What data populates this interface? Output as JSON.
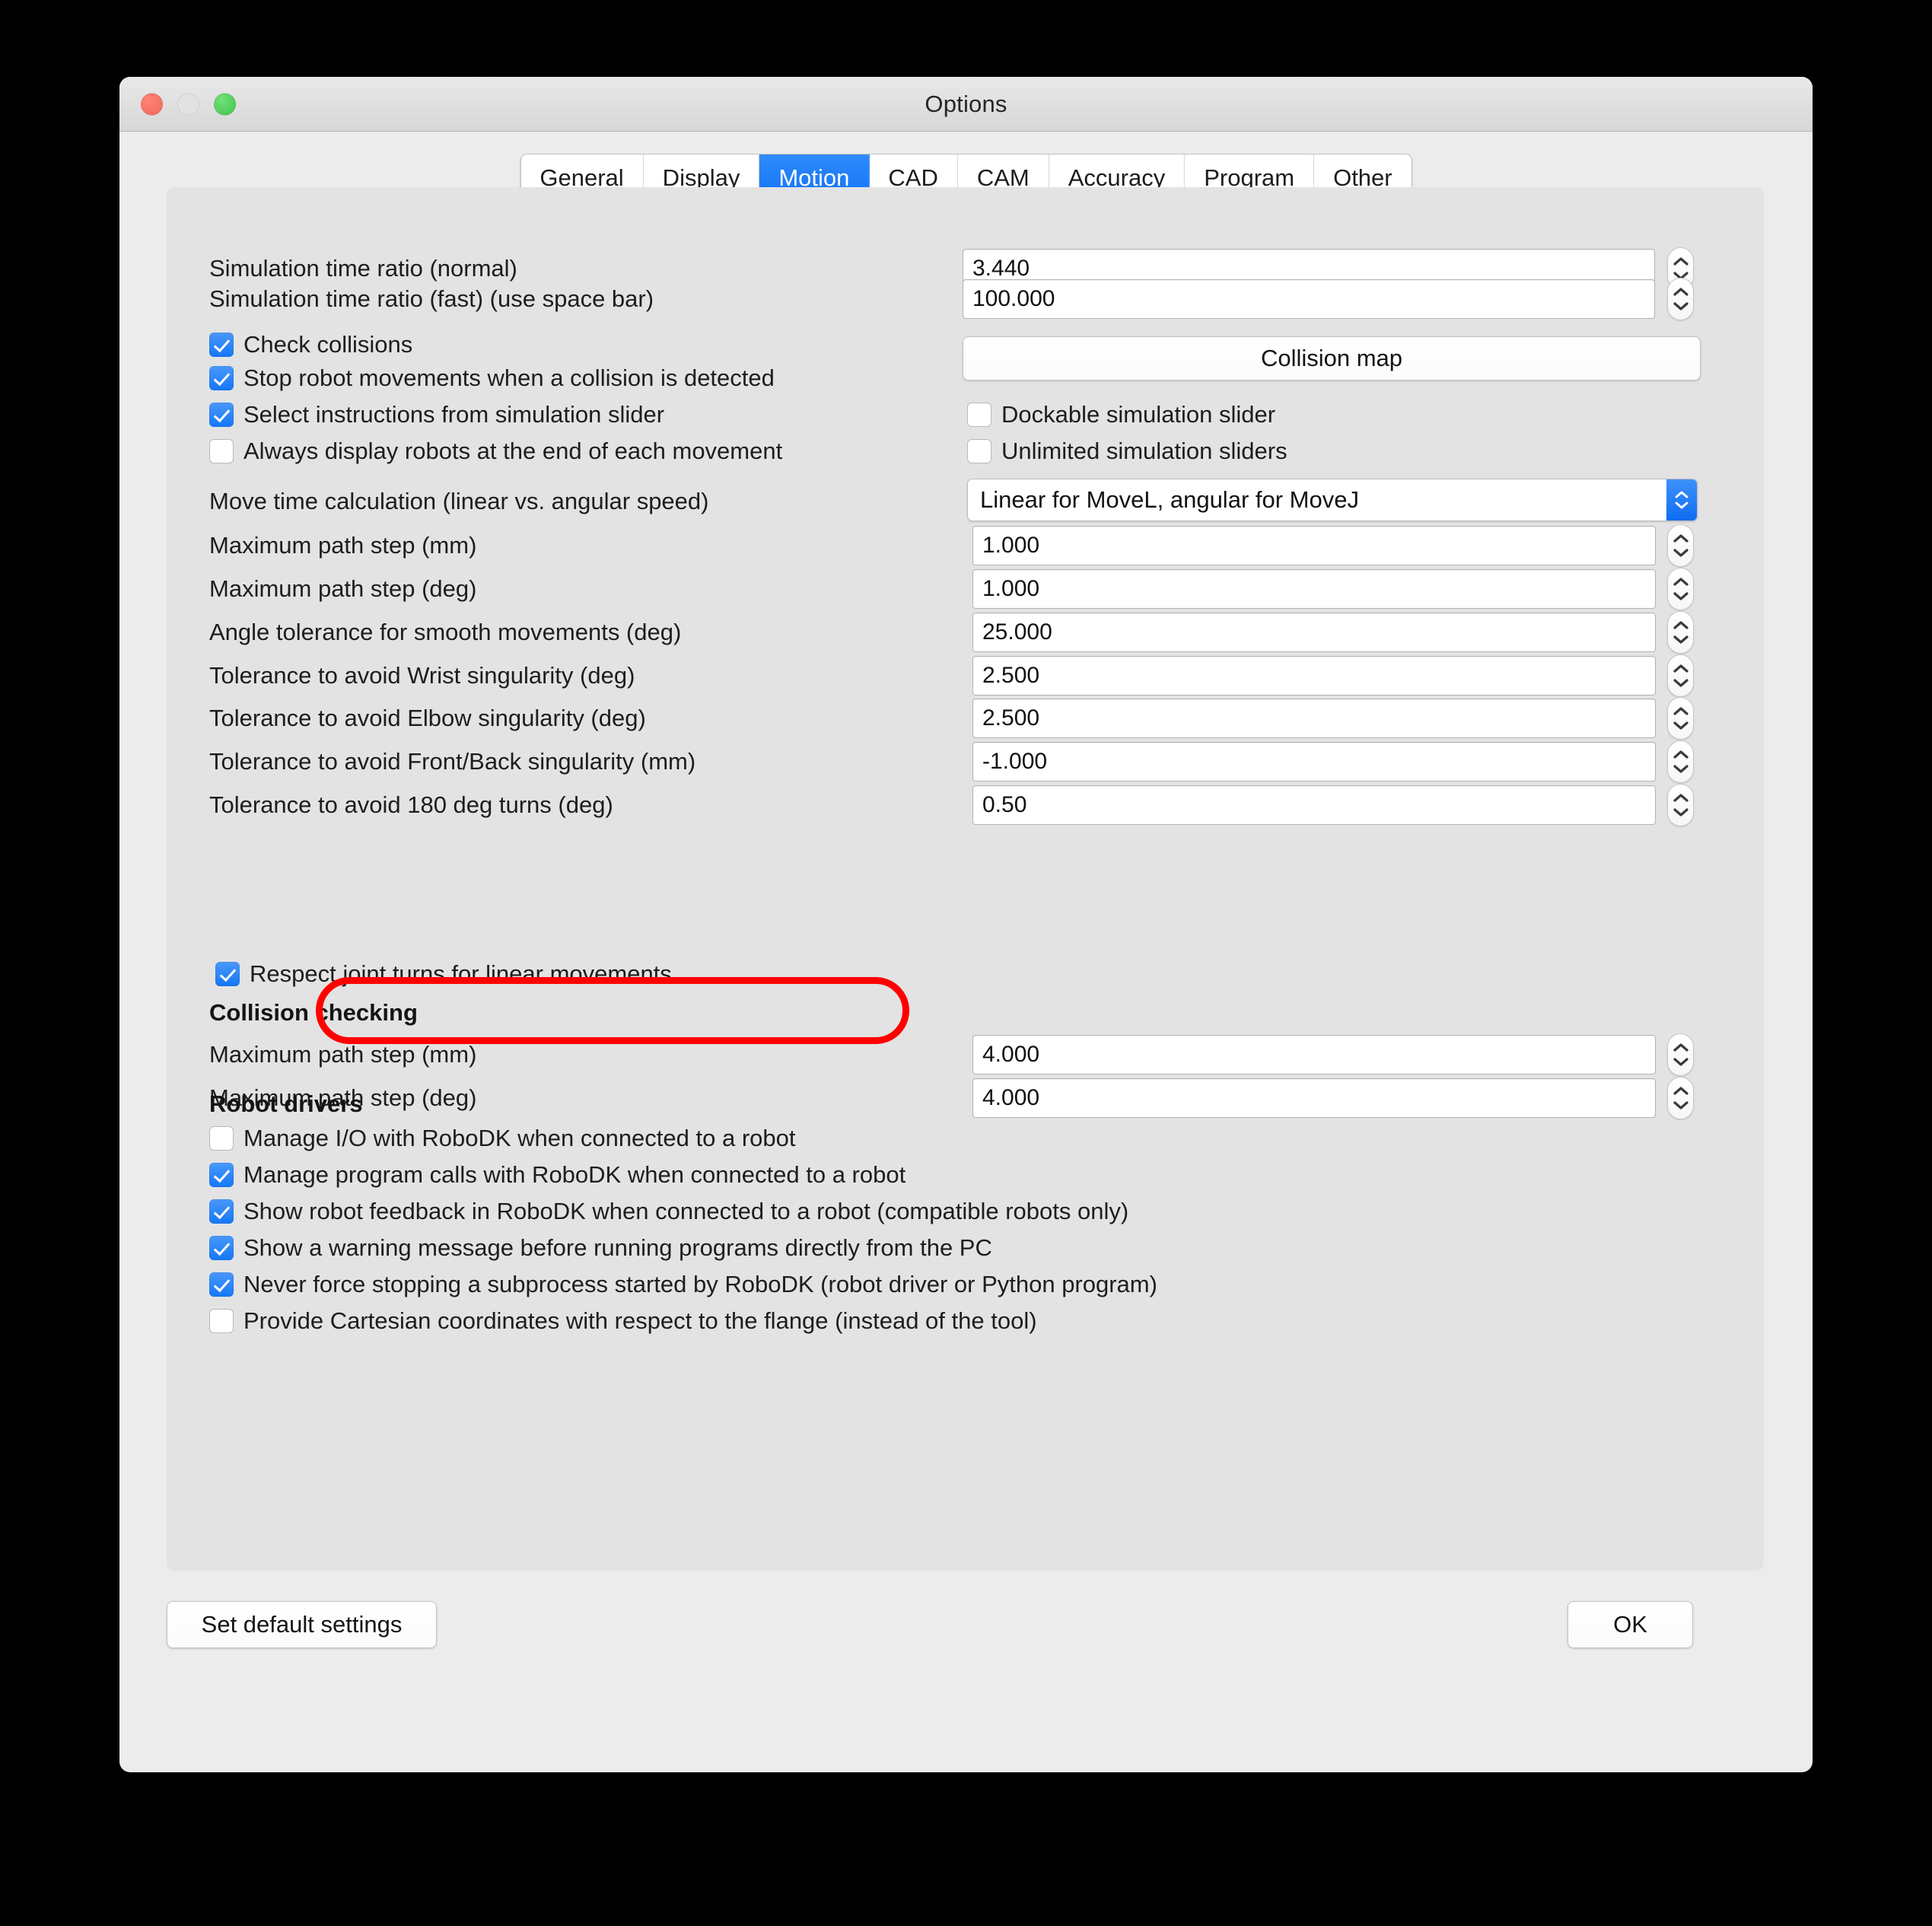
{
  "window": {
    "title": "Options",
    "traffic_lights": [
      "close-button",
      "minimize-button",
      "zoom-button"
    ]
  },
  "tabs": [
    {
      "label": "General",
      "active": false
    },
    {
      "label": "Display",
      "active": false
    },
    {
      "label": "Motion",
      "active": true
    },
    {
      "label": "CAD",
      "active": false
    },
    {
      "label": "CAM",
      "active": false
    },
    {
      "label": "Accuracy",
      "active": false
    },
    {
      "label": "Program",
      "active": false
    },
    {
      "label": "Other",
      "active": false
    }
  ],
  "motion": {
    "sim_ratio_normal": {
      "label": "Simulation time ratio (normal)",
      "value": "3.440"
    },
    "sim_ratio_fast": {
      "label": "Simulation time ratio (fast)  (use space bar)",
      "value": "100.000"
    },
    "collision_map_button": "Collision map",
    "checks_left": [
      {
        "label": "Check collisions",
        "checked": true
      },
      {
        "label": "Stop robot movements when a collision is detected",
        "checked": true
      },
      {
        "label": "Select instructions from simulation slider",
        "checked": true
      },
      {
        "label": "Always display robots at the end of each movement",
        "checked": false
      }
    ],
    "checks_right": [
      {
        "label": "Dockable simulation slider",
        "checked": false
      },
      {
        "label": "Unlimited simulation sliders",
        "checked": false
      }
    ],
    "move_time": {
      "label": "Move time calculation (linear vs. angular speed)",
      "value": "Linear for MoveL, angular for MoveJ"
    },
    "tolerances": [
      {
        "label": "Maximum path step (mm)",
        "value": "1.000"
      },
      {
        "label": "Maximum path step (deg)",
        "value": "1.000"
      },
      {
        "label": "Angle tolerance for smooth movements (deg)",
        "value": "25.000"
      },
      {
        "label": "Tolerance to avoid Wrist singularity (deg)",
        "value": "2.500"
      },
      {
        "label": "Tolerance to avoid Elbow singularity (deg)",
        "value": "2.500"
      },
      {
        "label": "Tolerance to avoid Front/Back singularity (mm)",
        "value": "-1.000"
      },
      {
        "label": "Tolerance to avoid 180 deg turns (deg)",
        "value": "0.50"
      }
    ],
    "respect_joint_turns": {
      "label": "Respect joint turns for linear movements",
      "checked": true,
      "highlighted": true
    },
    "collision_checking": {
      "heading": "Collision checking",
      "fields": [
        {
          "label": "Maximum path step (mm)",
          "value": "4.000"
        },
        {
          "label": "Maximum path step (deg)",
          "value": "4.000"
        }
      ]
    },
    "robot_drivers": {
      "heading": "Robot drivers",
      "items": [
        {
          "label": "Manage I/O with RoboDK when connected to a robot",
          "checked": false
        },
        {
          "label": "Manage program calls with RoboDK when connected to a robot",
          "checked": true
        },
        {
          "label": "Show robot feedback in RoboDK when connected to a robot (compatible robots only)",
          "checked": true
        },
        {
          "label": "Show a warning message before running programs directly from the PC",
          "checked": true
        },
        {
          "label": "Never force stopping a subprocess started by RoboDK (robot driver or Python program)",
          "checked": true
        },
        {
          "label": "Provide Cartesian coordinates with respect to the flange (instead of the tool)",
          "checked": false
        }
      ]
    }
  },
  "footer": {
    "set_defaults_label": "Set default settings",
    "ok_label": "OK"
  },
  "colors": {
    "accent_blue": "#1478f6",
    "tab_active_blue": "#1172f5",
    "annotation_red": "#ff0000",
    "window_bg": "#ececec",
    "panel_bg": "#e3e3e3"
  }
}
